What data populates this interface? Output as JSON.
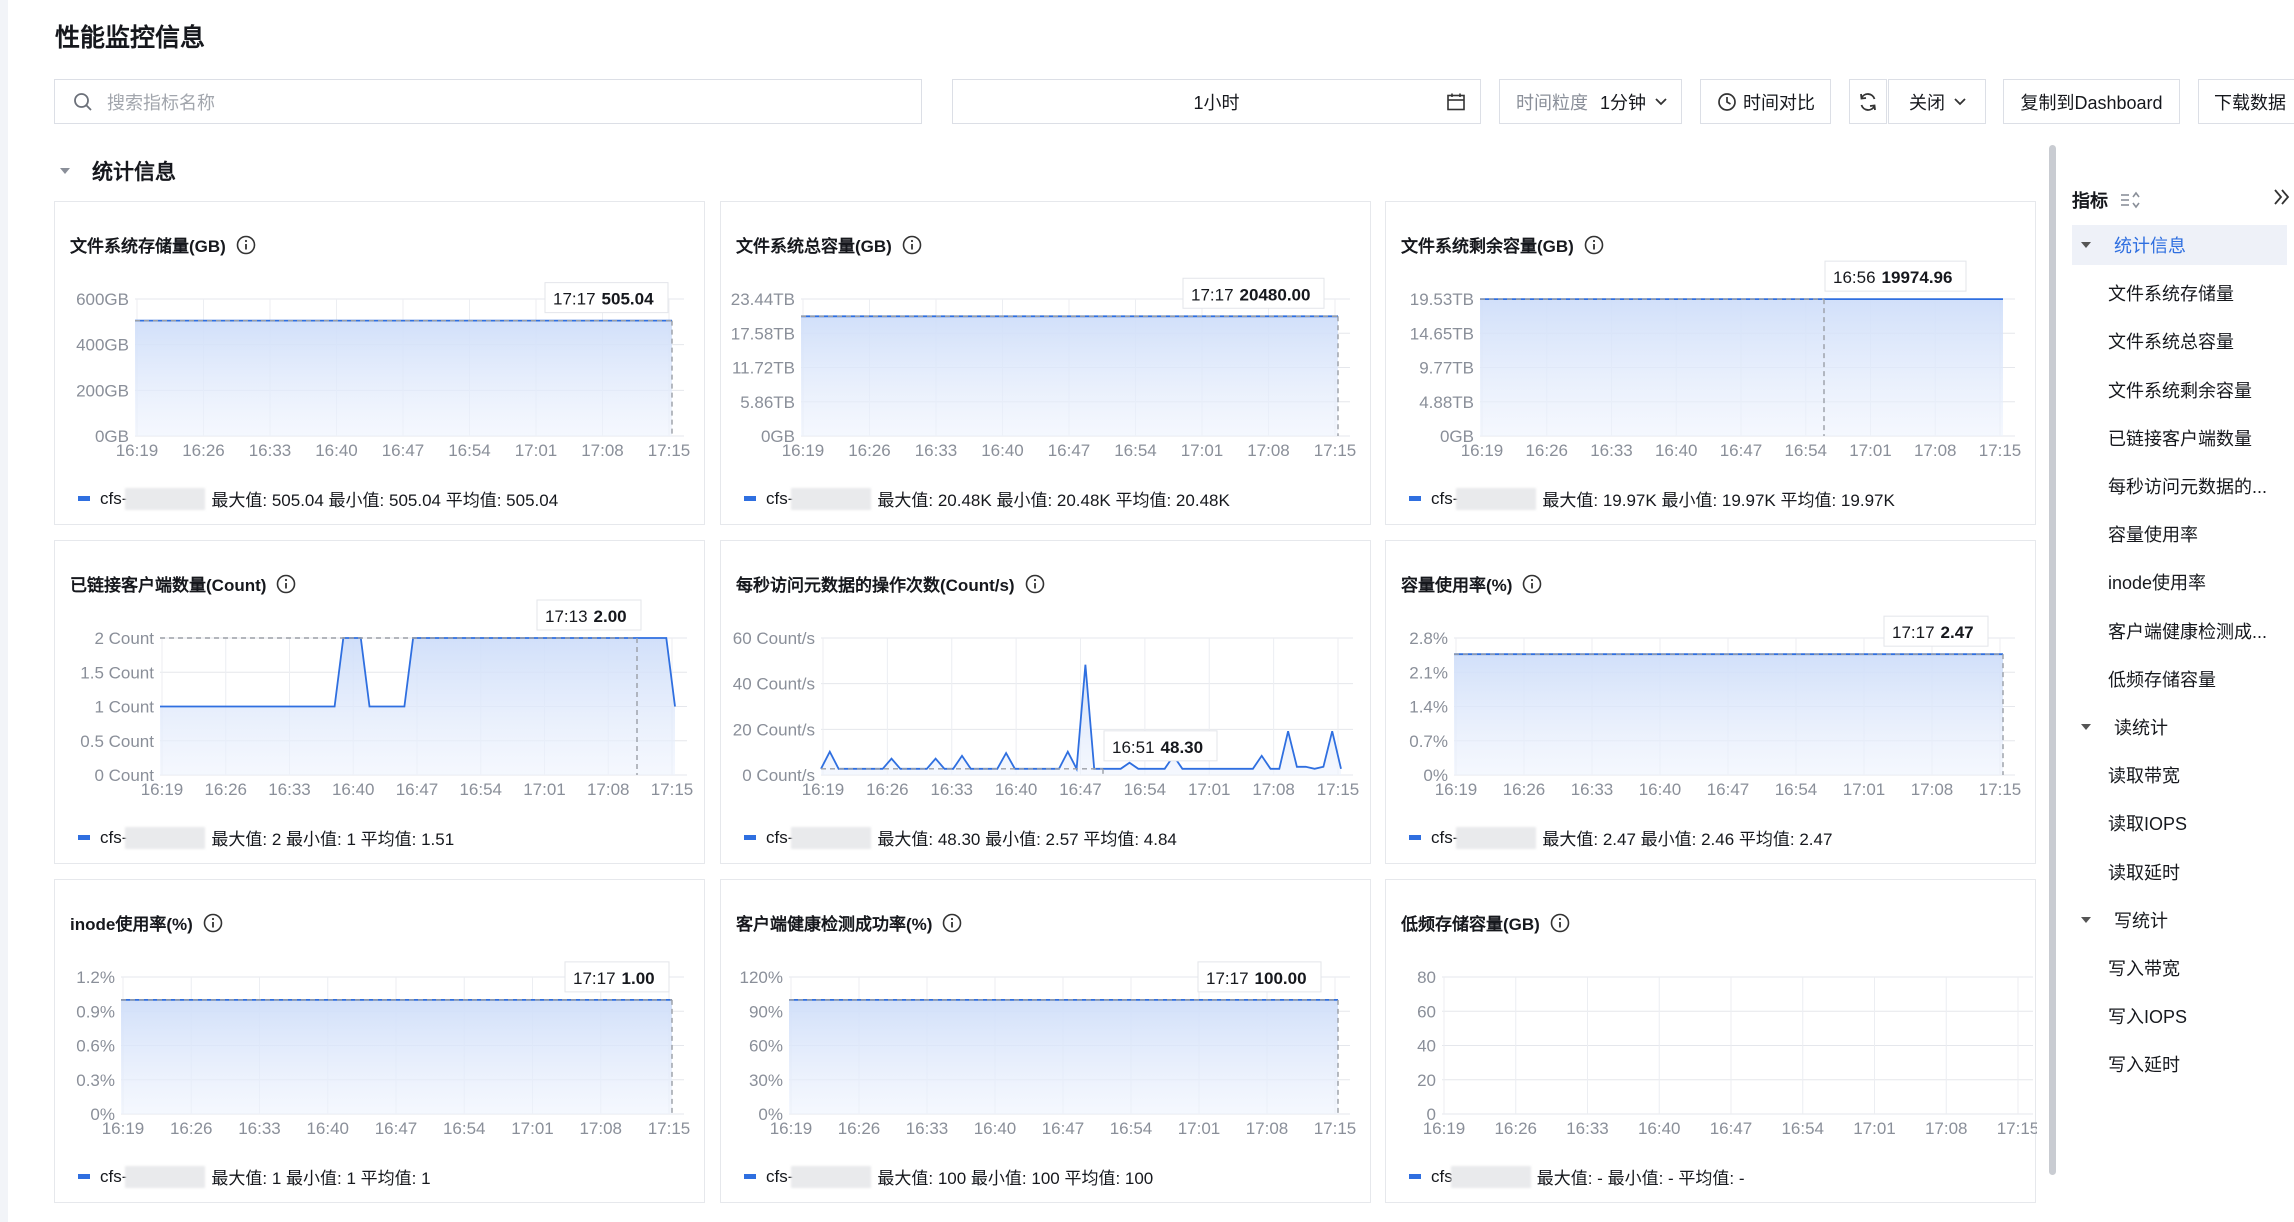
{
  "page": {
    "title": "性能监控信息"
  },
  "toolbar": {
    "search_placeholder": "搜索指标名称",
    "time_range": "1小时",
    "granularity_label": "时间粒度",
    "granularity_value": "1分钟",
    "compare_label": "时间对比",
    "auto_refresh_value": "关闭",
    "copy_label": "复制到Dashboard",
    "download_label": "下载数据"
  },
  "section": {
    "title": "统计信息"
  },
  "x_ticks": [
    "16:19",
    "16:26",
    "16:33",
    "16:40",
    "16:47",
    "16:54",
    "17:01",
    "17:08",
    "17:15"
  ],
  "charts": [
    {
      "title": "文件系统存储量(GB)",
      "yticks": [
        "600GB",
        "400GB",
        "200GB",
        "0GB"
      ],
      "tip_time": "17:17",
      "tip_value": "505.04",
      "legend_name": "cfs-",
      "legend_suffix": "",
      "legend_stats": "最大值: 505.04  最小值: 505.04  平均值: 505.04"
    },
    {
      "title": "文件系统总容量(GB)",
      "yticks": [
        "23.44TB",
        "17.58TB",
        "11.72TB",
        "5.86TB",
        "0GB"
      ],
      "tip_time": "17:17",
      "tip_value": "20480.00",
      "legend_name": "cfs-",
      "legend_suffix": "",
      "legend_stats": "最大值: 20.48K  最小值: 20.48K  平均值: 20.48K"
    },
    {
      "title": "文件系统剩余容量(GB)",
      "yticks": [
        "19.53TB",
        "14.65TB",
        "9.77TB",
        "4.88TB",
        "0GB"
      ],
      "tip_time": "16:56",
      "tip_value": "19974.96",
      "legend_name": "cfs-",
      "legend_suffix": "",
      "legend_stats": "最大值: 19.97K  最小值: 19.97K  平均值: 19.97K"
    },
    {
      "title": "已链接客户端数量(Count)",
      "yticks": [
        "2 Count",
        "1.5 Count",
        "1 Count",
        "0.5 Count",
        "0 Count"
      ],
      "tip_time": "17:13",
      "tip_value": "2.00",
      "legend_name": "cfs-",
      "legend_suffix": "",
      "legend_stats": "最大值: 2  最小值: 1  平均值: 1.51"
    },
    {
      "title": "每秒访问元数据的操作次数(Count/s)",
      "yticks": [
        "60 Count/s",
        "40 Count/s",
        "20 Count/s",
        "0 Count/s"
      ],
      "tip_time": "16:51",
      "tip_value": "48.30",
      "legend_name": "cfs-",
      "legend_suffix": "",
      "legend_stats": "最大值: 48.30  最小值: 2.57  平均值: 4.84"
    },
    {
      "title": "容量使用率(%)",
      "yticks": [
        "2.8%",
        "2.1%",
        "1.4%",
        "0.7%",
        "0%"
      ],
      "tip_time": "17:17",
      "tip_value": "2.47",
      "legend_name": "cfs-",
      "legend_suffix": "",
      "legend_stats": "最大值: 2.47  最小值: 2.46  平均值: 2.47"
    },
    {
      "title": "inode使用率(%)",
      "yticks": [
        "1.2%",
        "0.9%",
        "0.6%",
        "0.3%",
        "0%"
      ],
      "tip_time": "17:17",
      "tip_value": "1.00",
      "legend_name": "cfs-",
      "legend_suffix": "",
      "legend_stats": "最大值: 1  最小值: 1  平均值: 1"
    },
    {
      "title": "客户端健康检测成功率(%)",
      "yticks": [
        "120%",
        "90%",
        "60%",
        "30%",
        "0%"
      ],
      "tip_time": "17:17",
      "tip_value": "100.00",
      "legend_name": "cfs-",
      "legend_suffix": "",
      "legend_stats": "最大值: 100  最小值: 100  平均值: 100"
    },
    {
      "title": "低频存储容量(GB)",
      "yticks": [
        "80",
        "60",
        "40",
        "20",
        "0"
      ],
      "tip_time": "",
      "tip_value": "",
      "legend_name": "cfs",
      "legend_suffix": "",
      "legend_stats": "最大值: -  最小值: -  平均值: -"
    }
  ],
  "sidebar": {
    "header": "指标",
    "items": [
      {
        "label": "统计信息",
        "group": true
      },
      {
        "label": "文件系统存储量",
        "group": false
      },
      {
        "label": "文件系统总容量",
        "group": false
      },
      {
        "label": "文件系统剩余容量",
        "group": false
      },
      {
        "label": "已链接客户端数量",
        "group": false
      },
      {
        "label": "每秒访问元数据的...",
        "group": false
      },
      {
        "label": "容量使用率",
        "group": false
      },
      {
        "label": "inode使用率",
        "group": false
      },
      {
        "label": "客户端健康检测成...",
        "group": false
      },
      {
        "label": "低频存储容量",
        "group": false
      },
      {
        "label": "读统计",
        "group": true
      },
      {
        "label": "读取带宽",
        "group": false
      },
      {
        "label": "读取IOPS",
        "group": false
      },
      {
        "label": "读取延时",
        "group": false
      },
      {
        "label": "写统计",
        "group": true
      },
      {
        "label": "写入带宽",
        "group": false
      },
      {
        "label": "写入IOPS",
        "group": false
      },
      {
        "label": "写入延时",
        "group": false
      }
    ]
  },
  "colors": {
    "accent": "#2f6fe0",
    "grid": "#e7e9ee",
    "area": "#dbe7fb"
  }
}
